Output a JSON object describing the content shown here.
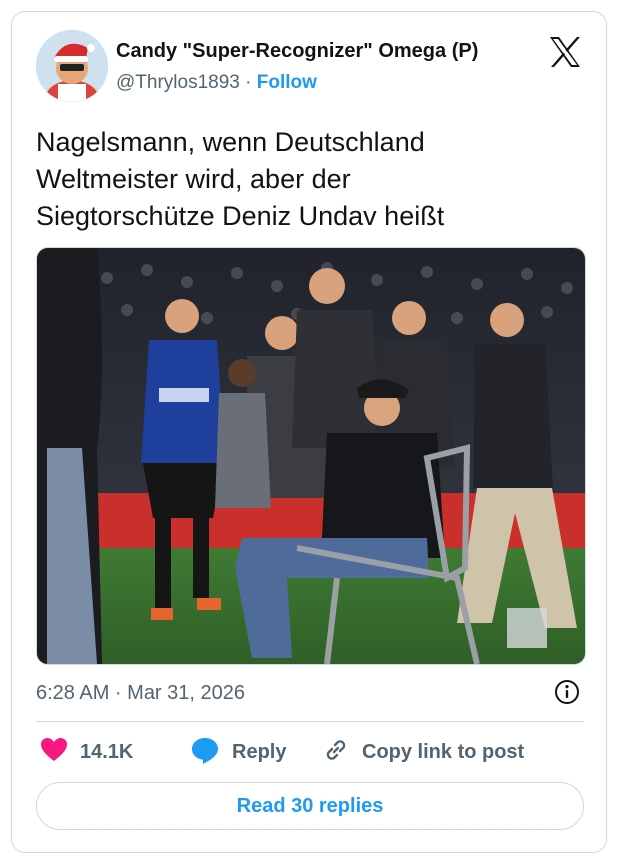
{
  "author": {
    "name": "Candy \"Super-Recognizer\" Omega (P)",
    "handle": "@Thrylos1893",
    "separator": " · ",
    "follow_label": "Follow"
  },
  "tweet": {
    "text": "Nagelsmann, wenn Deutschland\nWeltmeister wird, aber der\nSiegtorschütze Deniz Undav heißt"
  },
  "timestamp": "6:28 AM · Mar 31, 2026",
  "actions": {
    "likes": "14.1K",
    "reply_label": "Reply",
    "copy_label": "Copy link to post"
  },
  "read_replies_label": "Read 30 replies",
  "colors": {
    "accent": "#1d9bf0",
    "like": "#f91880",
    "muted": "#536471",
    "text": "#0f1419"
  },
  "icons": [
    "x-logo-icon",
    "info-icon",
    "heart-icon",
    "reply-bubble-icon",
    "link-icon"
  ]
}
